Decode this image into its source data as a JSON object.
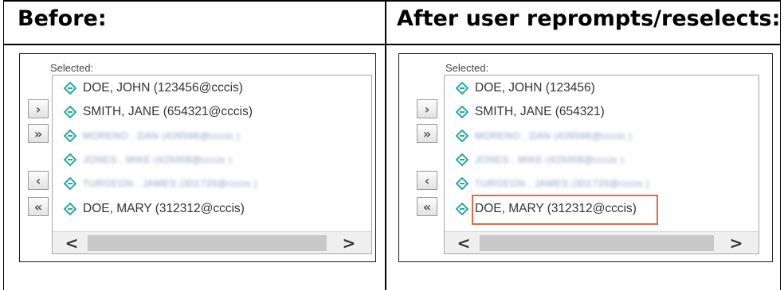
{
  "headings": {
    "before": "Before:",
    "after": "After user reprompts/reselects:"
  },
  "selected_label": "Selected:",
  "buttons": {
    "add": "›",
    "add_all": "»",
    "remove": "‹",
    "remove_all": "«"
  },
  "before_items": [
    {
      "text": "DOE, JOHN (123456@cccis)",
      "blurred": false
    },
    {
      "text": "SMITH, JANE (654321@cccis)",
      "blurred": false
    },
    {
      "text": "MORENO , DAN (426566@cccis )",
      "blurred": true
    },
    {
      "text": "JONES , MIKE (425009@cccis )",
      "blurred": true
    },
    {
      "text": "TURGEON , JAMES (301726@cccis )",
      "blurred": true
    },
    {
      "text": "DOE, MARY (312312@cccis)",
      "blurred": false
    }
  ],
  "after_items": [
    {
      "text": "DOE, JOHN (123456)",
      "blurred": false
    },
    {
      "text": "SMITH, JANE (654321)",
      "blurred": false
    },
    {
      "text": "MORENO , DAN (426566@cccis )",
      "blurred": true
    },
    {
      "text": "JONES , MIKE (425009@cccis )",
      "blurred": true
    },
    {
      "text": "TURGEON , JAMES (301726@cccis )",
      "blurred": true
    },
    {
      "text": "DOE, MARY (312312@cccis)",
      "blurred": false
    }
  ],
  "scroll": {
    "left": "<",
    "right": ">"
  },
  "colors": {
    "icon": "#2aa6a6",
    "highlight": "#e06c4c"
  }
}
